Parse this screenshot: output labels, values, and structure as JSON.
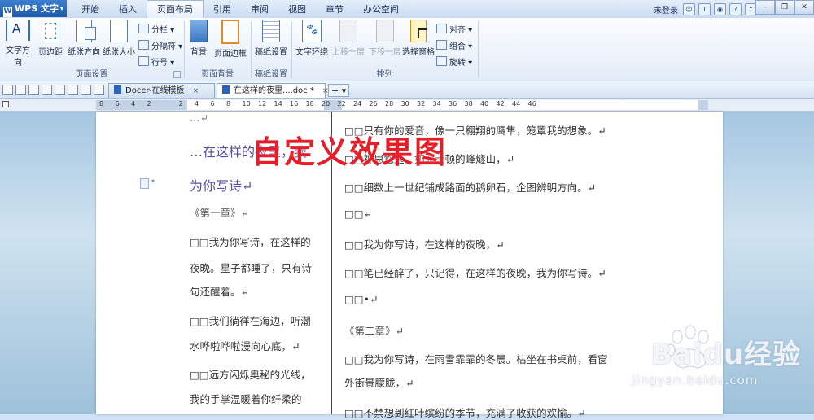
{
  "app": {
    "name": "WPS 文字",
    "logo": "W"
  },
  "menu_tabs": [
    "开始",
    "插入",
    "页面布局",
    "引用",
    "审阅",
    "视图",
    "章节",
    "办公空间"
  ],
  "active_tab_index": 2,
  "account": {
    "login_text": "未登录"
  },
  "ribbon": {
    "page_setup": {
      "group_label": "页面设置",
      "text_direction": "文字方向",
      "margins": "页边距",
      "orientation": "纸张方向",
      "size": "纸张大小",
      "columns": "分栏",
      "breaks": "分隔符",
      "line_numbers": "行号"
    },
    "page_background": {
      "group_label": "页面背景",
      "background": "背景",
      "page_border": "页面边框"
    },
    "draft_paper": {
      "group_label": "稿纸设置",
      "draft_setup": "稿纸设置"
    },
    "arrange": {
      "group_label": "排列",
      "text_wrap": "文字环绕",
      "bring_forward": "上移一层",
      "send_backward": "下移一层",
      "selection_pane": "选择窗格",
      "align": "对齐",
      "group": "组合",
      "rotate": "旋转"
    }
  },
  "doc_tabs": [
    {
      "label": "Docer-在线模板",
      "close": "×"
    },
    {
      "label": "在这样的夜里....doc *",
      "close": "×"
    }
  ],
  "new_tab": "+",
  "ruler_numbers": [
    "8",
    "6",
    "4",
    "2",
    "",
    "2",
    "4",
    "6",
    "8",
    "10",
    "12",
    "14",
    "16",
    "18",
    "20",
    "22",
    "24",
    "26",
    "28",
    "30",
    "32",
    "34",
    "36",
    "38",
    "40",
    "42",
    "44",
    "46"
  ],
  "document": {
    "left_column": [
      "…",
      "…在这样的夜里，我",
      "为你写诗",
      "《第一章》",
      "□□我为你写诗，在这样的",
      "夜晚。星子都睡了，只有诗",
      "句还醒着。",
      "□□我们徜徉在海边，听潮",
      "水哗啦哗啦漫向心底，",
      "□□远方闪烁奥秘的光线，",
      "我的手掌温暖着你纤柔的"
    ],
    "right_column": [
      "□□只有你的爱音，像一只翱翔的鹰隼，笼罩我的想象。",
      "□□神思悠远，如波士顿的峰燧山，",
      "□□细数上一世纪铺成路面的鹅卵石，企图辨明方向。",
      "□□",
      "□□我为你写诗，在这样的夜晚，",
      "□□笔已经醉了，只记得，在这样的夜晚，我为你写诗。",
      "□□•",
      "《第二章》",
      "□□我为你写诗，在雨雪霏霏的冬晨。枯坐在书桌前，看窗",
      "外街景朦胧，",
      "□□不禁想到红叶缤纷的季节，充满了收获的欢愉。"
    ],
    "paragraph_mark": "↵"
  },
  "overlay_caption": "自定义效果图",
  "watermark": {
    "text": "Baidu经验",
    "url": "jingyan.baidu.com"
  },
  "colors": {
    "accent": "#1f5aa8",
    "heading": "#5e4fa3",
    "overlay": "#e61e2a"
  }
}
